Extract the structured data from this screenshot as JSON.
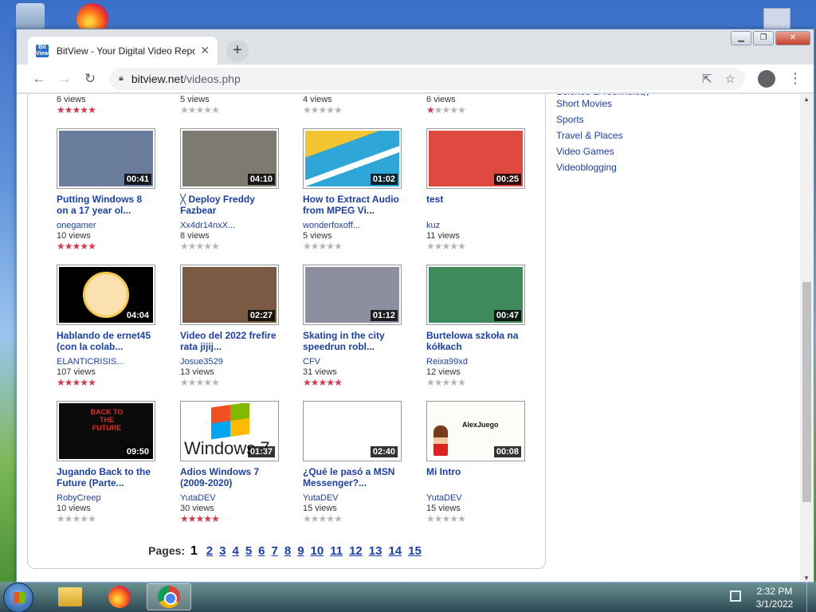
{
  "browser": {
    "tab_title": "BitView - Your Digital Video Repo",
    "tab_favicon_text": "Bit View",
    "url_domain": "bitview.net",
    "url_path": "/videos.php"
  },
  "top_partial_row": [
    {
      "views": "6 views",
      "rating": 5
    },
    {
      "views": "5 views",
      "rating": 0
    },
    {
      "views": "4 views",
      "rating": 0
    },
    {
      "views": "6 views",
      "rating": 1
    }
  ],
  "videos": [
    {
      "title": "Putting Windows 8 on a 17 year ol...",
      "author": "onegamer",
      "views": "10 views",
      "duration": "00:41",
      "rating": 5,
      "thumb": "#6a7d9c"
    },
    {
      "title": "╳ Deploy Freddy Fazbear",
      "author": "Xx4dr14nxX...",
      "views": "8 views",
      "duration": "04:10",
      "rating": 0,
      "thumb": "#7d7a72"
    },
    {
      "title": "How to Extract Audio from MPEG Vi...",
      "author": "wonderfoxoff...",
      "views": "5 views",
      "duration": "01:02",
      "rating": 0,
      "thumb": "#2ea6d8"
    },
    {
      "title": "test",
      "author": "kuz",
      "views": "11 views",
      "duration": "00:25",
      "rating": 0,
      "thumb": "#e0493f"
    },
    {
      "title": "Hablando de ernet45 (con la colab...",
      "author": "ELANTICRISIS...",
      "views": "107 views",
      "duration": "04:04",
      "rating": 5,
      "thumb": "#f4c94a"
    },
    {
      "title": "Video del 2022 frefire rata jijij...",
      "author": "Josue3529",
      "views": "13 views",
      "duration": "02:27",
      "rating": 0,
      "thumb": "#7a5a42"
    },
    {
      "title": "Skating in the city speedrun robl...",
      "author": "CFV",
      "views": "31 views",
      "duration": "01:12",
      "rating": 5,
      "thumb": "#8d8fa0"
    },
    {
      "title": "Burtelowa szkoła na kółkach",
      "author": "Reixa99xd",
      "views": "12 views",
      "duration": "00:47",
      "rating": 0,
      "thumb": "#3f8a5a"
    },
    {
      "title": "Jugando Back to the Future (Parte...",
      "author": "RobyCreep",
      "views": "10 views",
      "duration": "09:50",
      "rating": 0,
      "thumb": "#0a0a0a"
    },
    {
      "title": "Adios Windows 7 (2009-2020)",
      "author": "YutaDEV",
      "views": "30 views",
      "duration": "01:37",
      "rating": 5,
      "thumb": "#ffffff"
    },
    {
      "title": "¿Qué le pasó a MSN Messenger?...",
      "author": "YutaDEV",
      "views": "15 views",
      "duration": "02:40",
      "rating": 0,
      "thumb": "#ffffff"
    },
    {
      "title": "Mi Intro",
      "author": "YutaDEV",
      "views": "15 views",
      "duration": "00:08",
      "rating": 0,
      "thumb": "#fdfdf8"
    }
  ],
  "thumb_texts": {
    "windows7": "Windows 7",
    "alexjuego": "AlexJuego",
    "bttf": "BACK TO THE FUTURE"
  },
  "pagination": {
    "label": "Pages:",
    "current": "1",
    "pages": [
      "2",
      "3",
      "4",
      "5",
      "6",
      "7",
      "8",
      "9",
      "10",
      "11",
      "12",
      "13",
      "14",
      "15"
    ]
  },
  "categories": [
    "Science & Technology",
    "Short Movies",
    "Sports",
    "Travel & Places",
    "Video Games",
    "Videoblogging"
  ],
  "taskbar": {
    "time": "2:32 PM",
    "date": "3/1/2022"
  },
  "colors": {
    "link": "#1a3faa",
    "star_on": "#d8384e",
    "star_off": "#b5b5b5"
  }
}
